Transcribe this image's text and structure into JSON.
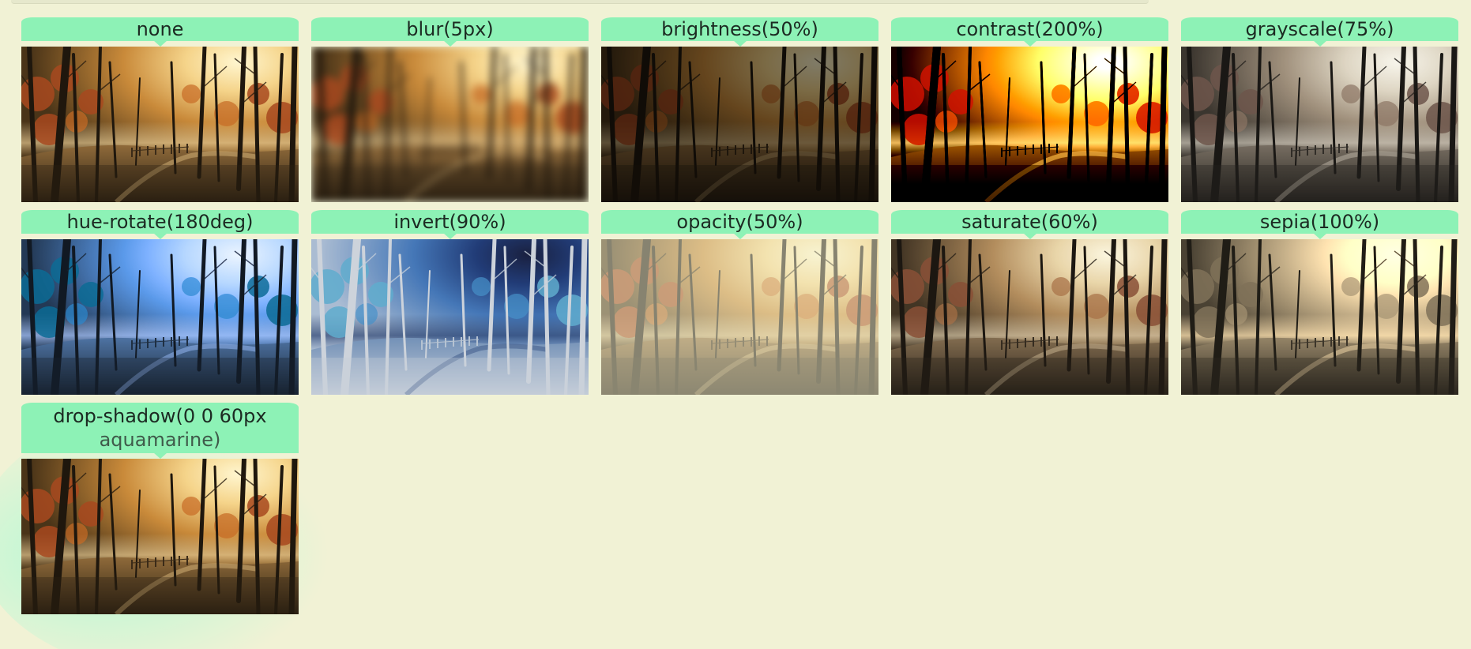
{
  "filters": [
    {
      "label": "none"
    },
    {
      "label": "blur(5px)"
    },
    {
      "label": "brightness(50%)"
    },
    {
      "label": "contrast(200%)"
    },
    {
      "label": "grayscale(75%)"
    },
    {
      "label": "hue-rotate(180deg)"
    },
    {
      "label": "invert(90%)"
    },
    {
      "label": "opacity(50%)"
    },
    {
      "label": "saturate(60%)"
    },
    {
      "label": "sepia(100%)"
    },
    {
      "label_line1": "drop-shadow(0 0 60px",
      "label_line2": "aquamarine)"
    }
  ],
  "colors": {
    "background": "#f1f2d5",
    "label_bg": "#8df2b6",
    "shadow": "aquamarine"
  }
}
